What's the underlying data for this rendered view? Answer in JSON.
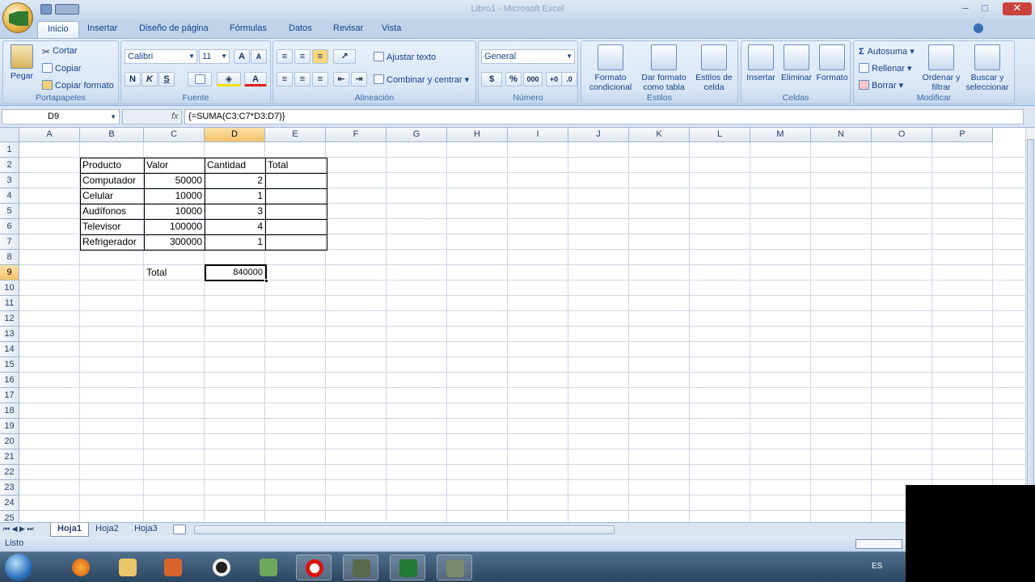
{
  "window": {
    "title": "Libro1 - Microsoft Excel",
    "min_label": "–",
    "max_label": "□",
    "close_label": "✕"
  },
  "ribbon_tabs": [
    "Inicio",
    "Insertar",
    "Diseño de página",
    "Fórmulas",
    "Datos",
    "Revisar",
    "Vista"
  ],
  "clipboard": {
    "paste": "Pegar",
    "cut": "Cortar",
    "copy": "Copiar",
    "format_painter": "Copiar formato",
    "label": "Portapapeles"
  },
  "font": {
    "name": "Calibri",
    "size": "11",
    "grow": "A",
    "shrink": "A",
    "bold": "N",
    "italic": "K",
    "underline": "S",
    "color_letter": "A",
    "label": "Fuente"
  },
  "alignment": {
    "wrap_text": "Ajustar texto",
    "merge_center": "Combinar y centrar",
    "label": "Alineación"
  },
  "number": {
    "format": "General",
    "currency": "$",
    "percent": "%",
    "thousands": "000",
    "label": "Número"
  },
  "styles": {
    "conditional": "Formato condicional",
    "as_table": "Dar formato como tabla",
    "cell_styles": "Estilos de celda",
    "label": "Estilos"
  },
  "cells": {
    "insert": "Insertar",
    "delete": "Eliminar",
    "format": "Formato",
    "label": "Celdas"
  },
  "editing": {
    "autosum": "Autosuma",
    "fill": "Rellenar",
    "clear": "Borrar",
    "sort": "Ordenar y filtrar",
    "find": "Buscar y seleccionar",
    "label": "Modificar"
  },
  "formula_bar": {
    "name_box": "D9",
    "fx": "fx",
    "formula": "{=SUMA(C3:C7*D3:D7)}"
  },
  "columns": [
    "A",
    "B",
    "C",
    "D",
    "E",
    "F",
    "G",
    "H",
    "I",
    "J",
    "K",
    "L",
    "M",
    "N",
    "O",
    "P"
  ],
  "selected_column": "D",
  "rows": [
    "1",
    "2",
    "3",
    "4",
    "5",
    "6",
    "7",
    "8",
    "9",
    "10",
    "11",
    "12",
    "13",
    "14",
    "15",
    "16",
    "17",
    "18",
    "19",
    "20",
    "21",
    "22",
    "23",
    "24",
    "25"
  ],
  "selected_row": "9",
  "table": {
    "headers": [
      "Producto",
      "Valor",
      "Cantidad",
      "Total"
    ],
    "rows": [
      [
        "Computador",
        "50000",
        "2",
        ""
      ],
      [
        "Celular",
        "10000",
        "1",
        ""
      ],
      [
        "Audífonos",
        "10000",
        "3",
        ""
      ],
      [
        "Televisor",
        "100000",
        "4",
        ""
      ],
      [
        "Refrigerador",
        "300000",
        "1",
        ""
      ]
    ]
  },
  "total": {
    "label": "Total",
    "value": "840000"
  },
  "sheets": [
    "Hoja1",
    "Hoja2",
    "Hoja3"
  ],
  "active_sheet": "Hoja1",
  "status": {
    "text": "Listo",
    "language": "ES"
  },
  "taskbar_icons": [
    "start-orb-icon",
    "firefox-icon",
    "explorer-icon",
    "media-player-icon",
    "opera-o-icon",
    "network-icon",
    "opera-icon",
    "app-icon",
    "excel-icon",
    "paint-icon"
  ],
  "colors": {
    "accent": "#15428b",
    "selection": "#f5c26a",
    "excel_green": "#1f7a34"
  }
}
